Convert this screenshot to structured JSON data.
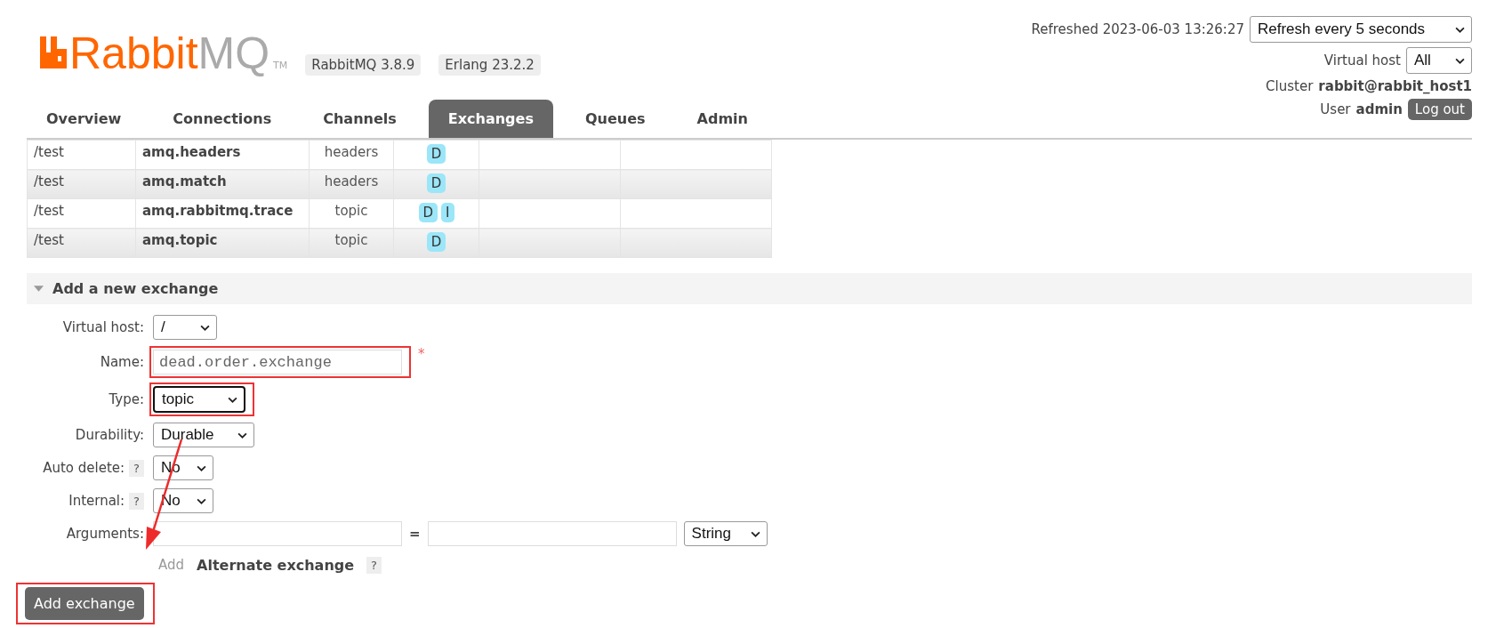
{
  "header": {
    "logo": {
      "word_1": "Rabbit",
      "word_2": "MQ",
      "tm": "TM"
    },
    "versions": [
      "RabbitMQ 3.8.9",
      "Erlang 23.2.2"
    ],
    "refreshed": "Refreshed 2023-06-03 13:26:27",
    "refresh_select": "Refresh every 5 seconds",
    "virtual_host_label": "Virtual host",
    "virtual_host_select": "All",
    "cluster_label": "Cluster",
    "cluster": "rabbit@rabbit_host1",
    "user_label": "User",
    "user": "admin",
    "logout": "Log out"
  },
  "tabs": [
    {
      "label": "Overview",
      "selected": false
    },
    {
      "label": "Connections",
      "selected": false
    },
    {
      "label": "Channels",
      "selected": false
    },
    {
      "label": "Exchanges",
      "selected": true
    },
    {
      "label": "Queues",
      "selected": false
    },
    {
      "label": "Admin",
      "selected": false
    }
  ],
  "table": {
    "rows": [
      {
        "column_1": "/test",
        "column_2": "amq.headers",
        "column_3": "headers",
        "features": [
          "D"
        ]
      },
      {
        "column_1": "/test",
        "column_2": "amq.match",
        "column_3": "headers",
        "features": [
          "D"
        ]
      },
      {
        "column_1": "/test",
        "column_2": "amq.rabbitmq.trace",
        "column_3": "topic",
        "features": [
          "D",
          "I"
        ]
      },
      {
        "column_1": "/test",
        "column_2": "amq.topic",
        "column_3": "topic",
        "features": [
          "D"
        ]
      }
    ]
  },
  "add_exchange": {
    "title": "Add a new exchange",
    "expanded": true,
    "fields": [
      {
        "kind": "select",
        "label": "Virtual host:",
        "value": "/",
        "highlighted": false
      },
      {
        "kind": "text",
        "label": "Name:",
        "value": "dead.order.exchange",
        "required_mark": "*",
        "highlighted": true
      },
      {
        "kind": "select",
        "label": "Type:",
        "value": "topic",
        "highlighted": true,
        "focused": true
      },
      {
        "kind": "select",
        "label": "Durability:",
        "value": "Durable",
        "highlighted": false
      },
      {
        "kind": "select",
        "label": "Auto delete:",
        "help": "?",
        "value": "No",
        "highlighted": false
      },
      {
        "kind": "select",
        "label": "Internal:",
        "help": "?",
        "value": "No",
        "highlighted": false
      }
    ],
    "arguments": {
      "label": "Arguments:",
      "equals": "=",
      "type_select": "String",
      "add_link": "Add",
      "alternate_label": "Alternate exchange",
      "alternate_help": "?"
    },
    "submit": {
      "label": "Add exchange",
      "highlighted": true
    }
  }
}
